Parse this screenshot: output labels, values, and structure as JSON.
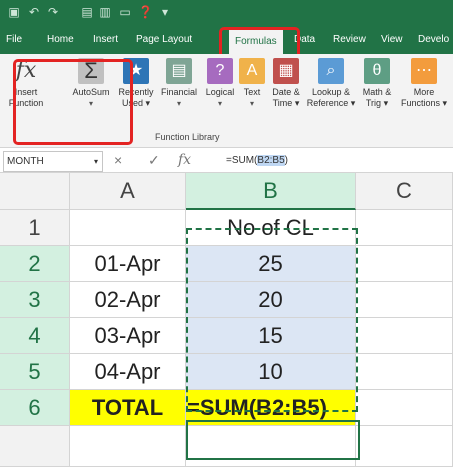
{
  "qat": {
    "save_icon": "save-icon",
    "undo_icon": "undo-icon",
    "redo_icon": "redo-icon",
    "help_icon": "help-icon"
  },
  "tabs": [
    {
      "label": "File"
    },
    {
      "label": "Home"
    },
    {
      "label": "Insert"
    },
    {
      "label": "Page Layout"
    },
    {
      "label": "Formulas",
      "active": true
    },
    {
      "label": "Data"
    },
    {
      "label": "Review"
    },
    {
      "label": "View"
    },
    {
      "label": "Develo"
    }
  ],
  "ribbon": {
    "insert_function": {
      "line1": "Insert",
      "line2": "Function",
      "glyph": "fx"
    },
    "autosum": {
      "line1": "AutoSum",
      "glyph": "Σ"
    },
    "recently_used": {
      "line1": "Recently",
      "line2": "Used"
    },
    "financial": {
      "line1": "Financial"
    },
    "logical": {
      "line1": "Logical"
    },
    "text": {
      "line1": "Text"
    },
    "date_time": {
      "line1": "Date &",
      "line2": "Time"
    },
    "lookup": {
      "line1": "Lookup &",
      "line2": "Reference"
    },
    "math": {
      "line1": "Math &",
      "line2": "Trig"
    },
    "more": {
      "line1": "More",
      "line2": "Functions"
    },
    "group_label": "Function Library"
  },
  "formula_bar": {
    "name_box": "MONTH",
    "cancel": "×",
    "enter": "✓",
    "fx": "fx",
    "formula_prefix": "=SUM(",
    "formula_ref": "B2:B5",
    "formula_suffix": ")"
  },
  "grid": {
    "columns": [
      "A",
      "B",
      "C"
    ],
    "rows": [
      {
        "num": "1",
        "a": "",
        "b": "No of CL"
      },
      {
        "num": "2",
        "a": "01-Apr",
        "b": "25"
      },
      {
        "num": "3",
        "a": "02-Apr",
        "b": "20"
      },
      {
        "num": "4",
        "a": "03-Apr",
        "b": "15"
      },
      {
        "num": "5",
        "a": "04-Apr",
        "b": "10"
      },
      {
        "num": "6",
        "a": "TOTAL",
        "b": "=SUM(B2:B5)"
      }
    ]
  },
  "colors": {
    "excel_green": "#217346",
    "highlight_red": "#e32322",
    "yellow": "#ffff00",
    "selection_blue": "#dce6f4"
  }
}
